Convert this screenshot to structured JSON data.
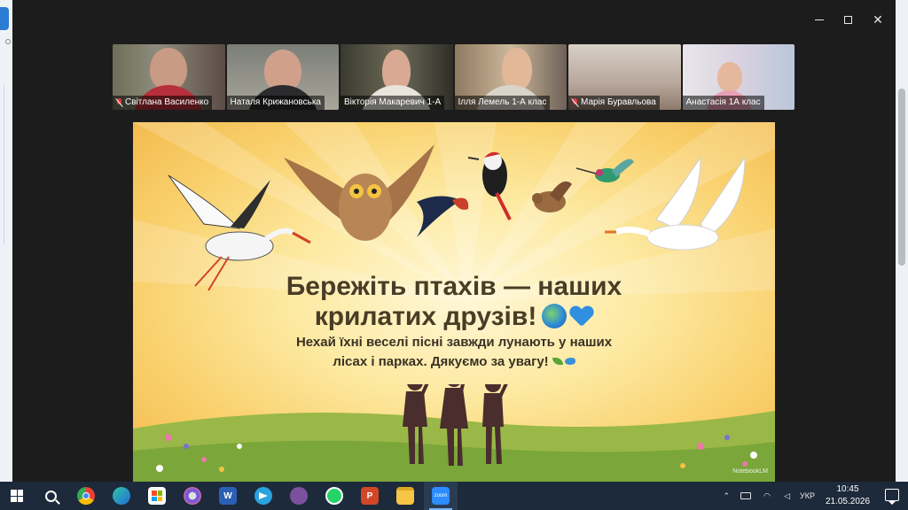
{
  "window": {
    "minimize_icon": "minimize-icon",
    "maximize_icon": "maximize-icon",
    "close_icon": "close-icon",
    "close_glyph": "✕"
  },
  "participants": [
    {
      "name": "Світлана Василенко",
      "muted": true
    },
    {
      "name": "Наталя Крижановська",
      "muted": false
    },
    {
      "name": "Вікторія Макаревич 1-А",
      "muted": false,
      "active": true
    },
    {
      "name": "Ілля  Лемель 1-А клас",
      "muted": false
    },
    {
      "name": "Марія Буравльова",
      "muted": true
    },
    {
      "name": "Анастасія 1А клас",
      "muted": false
    }
  ],
  "slide": {
    "title_line1": "Бережіть птахів — наших",
    "title_line2": "крилатих друзів!",
    "subtitle_line1": "Нехай їхні веселі пісні завжди лунають у наших",
    "subtitle_line2": "лісах і парках. Дякуємо за увагу!",
    "watermark": "NotebookLM",
    "colors": {
      "title": "#4a3d26",
      "sky_center": "#fff8d8",
      "sky_edge": "#f2b84a",
      "grass": "#7aa63a"
    }
  },
  "taskbar": {
    "apps": [
      {
        "icon": "windows-start-icon"
      },
      {
        "icon": "search-icon"
      },
      {
        "icon": "chrome-icon"
      },
      {
        "icon": "edge-icon"
      },
      {
        "icon": "store-icon"
      },
      {
        "icon": "network-app-icon"
      },
      {
        "icon": "word-icon",
        "letter": "W"
      },
      {
        "icon": "telegram-icon"
      },
      {
        "icon": "viber-icon"
      },
      {
        "icon": "whatsapp-icon"
      },
      {
        "icon": "powerpoint-icon",
        "letter": "P"
      },
      {
        "icon": "file-explorer-icon"
      },
      {
        "icon": "zoom-icon",
        "letter": "zoom",
        "active": true
      }
    ],
    "tray": {
      "language": "УКР",
      "time": "10:45",
      "date": "21.05.2026"
    }
  }
}
